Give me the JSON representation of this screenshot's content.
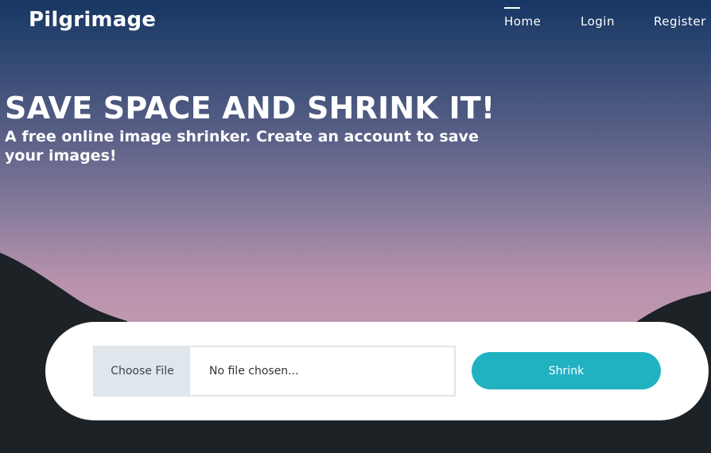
{
  "brand": "Pilgrimage",
  "nav": {
    "items": [
      {
        "label": "Home",
        "active": true
      },
      {
        "label": "Login",
        "active": false
      },
      {
        "label": "Register",
        "active": false
      }
    ]
  },
  "hero": {
    "headline": "SAVE SPACE AND SHRINK IT!",
    "subheadline": "A free online image shrinker. Create an account to save your images!"
  },
  "upload": {
    "choose_label": "Choose File",
    "file_status": "No file chosen...",
    "submit_label": "Shrink"
  },
  "colors": {
    "accent": "#21b2c2",
    "file_button_bg": "#dfe6ec",
    "mountain": "#1f2428"
  }
}
